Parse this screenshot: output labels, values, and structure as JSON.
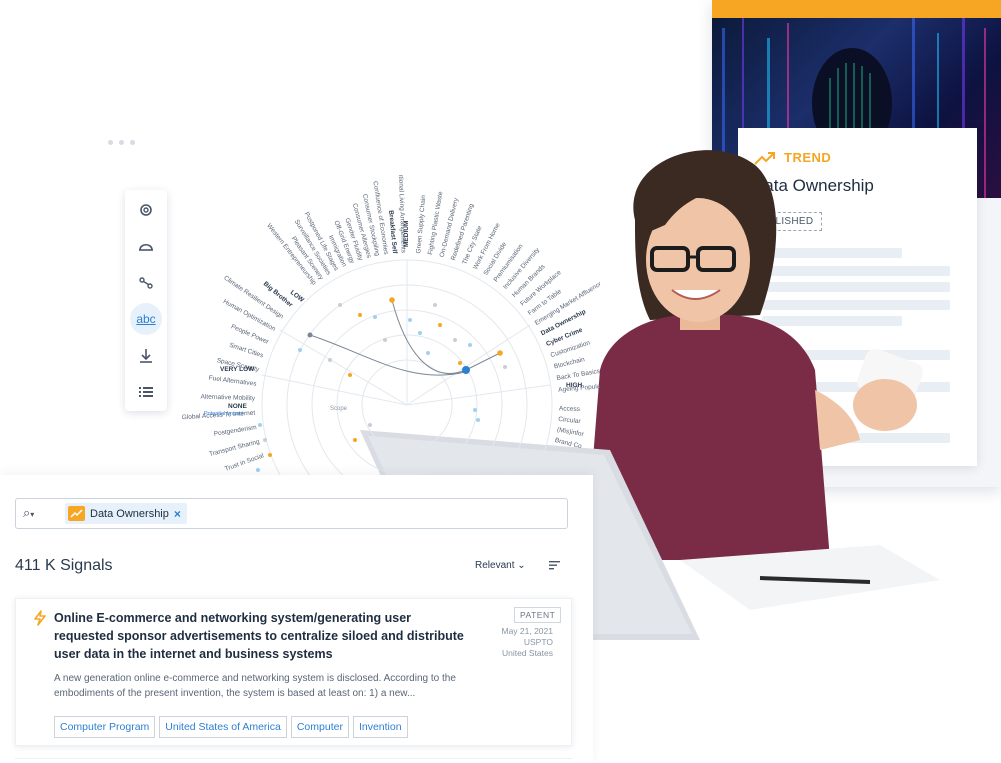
{
  "colors": {
    "accent": "#2d7fd3",
    "trend": "#f6a623",
    "text": "#1f2d40"
  },
  "trend_card": {
    "label": "TREND",
    "icon": "trend-up-icon",
    "title": "Data Ownership",
    "status": "UBLISHED"
  },
  "toolbar": {
    "items": [
      {
        "name": "gear-icon",
        "glyph": "⚙"
      },
      {
        "name": "dome-icon",
        "glyph": "⌓"
      },
      {
        "name": "connection-icon",
        "glyph": "⋰"
      },
      {
        "name": "text-label-toggle",
        "glyph": "abc"
      },
      {
        "name": "download-icon",
        "glyph": "⤓"
      },
      {
        "name": "list-icon",
        "glyph": "☰"
      }
    ]
  },
  "radar": {
    "labels_left": [
      "Western Entrepreneurship",
      "Pleasant Scenery",
      "Surveillance Societies",
      "Postponed Life Stages",
      "Immigration",
      "Off-Grid Energy",
      "Gender Fluidity",
      "Consumer Allergies",
      "Consumer Stockpiling",
      "Confluence of Economies",
      "Breakfast Self",
      "Intentional Living Arrangements"
    ],
    "labels_right": [
      "Green Supply Chain",
      "Fighting Plastic Waste",
      "On-Demand Delivery",
      "Redefined Parenting",
      "The City State",
      "Work From Home",
      "Social Divide",
      "Premiumisation",
      "Inclusive Diversity",
      "Human Brands",
      "Future Workplace",
      "Farm to Table",
      "Emerging Market Affluence",
      "Data Ownership",
      "Cyber Crime",
      "Customization",
      "Blockchain",
      "Back To Basics",
      "Ageing Population"
    ],
    "labels_lower_left": [
      "Big Brother",
      "Climate Resilient Design",
      "Human Optimization",
      "People Power",
      "Smart Cities",
      "Space Scarcity",
      "Fuel Alternatives",
      "Alternative Mobility",
      "Global Access To Internet",
      "Postgenderism",
      "Transport Sharing",
      "Trust in Social"
    ],
    "labels_lower_right": [
      "Access",
      "Circular",
      "(Mis)infor",
      "Brand Co"
    ],
    "levels": [
      "MEDIUM",
      "LOW",
      "VERY LOW",
      "NONE",
      "HIGH"
    ],
    "impact_label": "Potential Impact",
    "scope_label": "Scope"
  },
  "search": {
    "chip_label": "Data Ownership",
    "chip_icon": "trend-up-icon"
  },
  "results": {
    "count": "411 K Signals",
    "sort_label": "Relevant",
    "items": [
      {
        "title": "Online E-commerce and networking system/generating user requested sponsor advertisements to centralize siloed and distribute user data in the internet and business systems",
        "type": "PATENT",
        "date": "May 21, 2021",
        "source": "USPTO",
        "country": "United States",
        "description": "A new generation online e-commerce and networking system is disclosed. According to the embodiments of the present invention, the system is based at least on: 1) a new...",
        "tags": [
          "Computer Program",
          "United States of America",
          "Computer",
          "Invention"
        ]
      }
    ]
  }
}
